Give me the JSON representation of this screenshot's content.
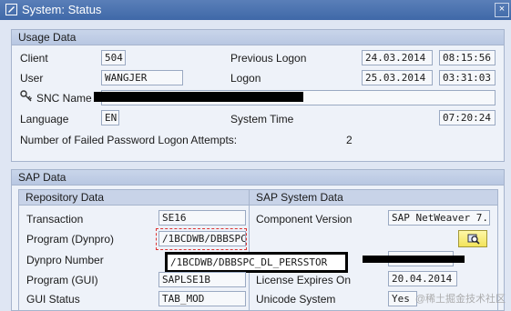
{
  "window": {
    "title": "System: Status",
    "close_label": "×"
  },
  "usage": {
    "title": "Usage Data",
    "client_label": "Client",
    "client": "504",
    "user_label": "User",
    "user": "WANGJER",
    "prev_logon_label": "Previous Logon",
    "prev_logon_date": "24.03.2014",
    "prev_logon_time": "08:15:56",
    "logon_label": "Logon",
    "logon_date": "25.03.2014",
    "logon_time": "03:31:03",
    "snc_label": "SNC Name",
    "language_label": "Language",
    "language": "EN",
    "system_time_label": "System Time",
    "system_time": "07:20:24",
    "failed_label": "Number of Failed Password Logon Attempts:",
    "failed": "2"
  },
  "sap": {
    "title": "SAP Data",
    "repo_title": "Repository Data",
    "transaction_label": "Transaction",
    "transaction": "SE16",
    "program_dynpro_label": "Program (Dynpro)",
    "program_dynpro": "/1BCDWB/DBBSPC",
    "dynpro_number_label": "Dynpro Number",
    "program_gui_label": "Program (GUI)",
    "program_gui": "SAPLSE1B",
    "gui_status_label": "GUI Status",
    "gui_status": "TAB_MOD",
    "highlight_value": "/1BCDWB/DBBSPC_DL_PERSSTOR",
    "sys_title": "SAP System Data",
    "component_label": "Component Version",
    "component": "SAP NetWeaver 7...",
    "license_label": "License Expires On",
    "license": "20.04.2014",
    "unicode_label": "Unicode System",
    "unicode": "Yes"
  },
  "watermark": "@稀土掘金技术社区",
  "colors": {
    "titlebar": "#4a72b0",
    "group_header": "#c0cde6",
    "background": "#dfe6f3"
  }
}
